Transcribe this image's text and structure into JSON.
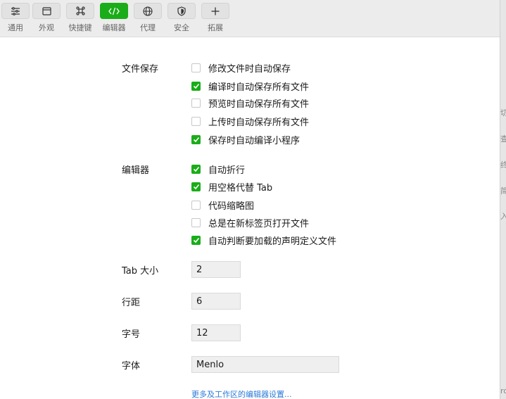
{
  "toolbar": {
    "items": [
      {
        "label": "通用",
        "icon": "sliders-icon",
        "active": false
      },
      {
        "label": "外观",
        "icon": "window-icon",
        "active": false
      },
      {
        "label": "快捷键",
        "icon": "command-icon",
        "active": false
      },
      {
        "label": "编辑器",
        "icon": "code-icon",
        "active": true
      },
      {
        "label": "代理",
        "icon": "globe-icon",
        "active": false
      },
      {
        "label": "安全",
        "icon": "shield-icon",
        "active": false
      },
      {
        "label": "拓展",
        "icon": "plus-icon",
        "active": false
      }
    ]
  },
  "accent_color": "#1aad19",
  "right_strip": {
    "glyphs": [
      "切",
      "查",
      "终",
      "简",
      "入",
      "ro"
    ]
  },
  "file_save": {
    "label": "文件保存",
    "options": [
      {
        "label": "修改文件时自动保存",
        "checked": false
      },
      {
        "label": "编译时自动保存所有文件",
        "checked": true
      },
      {
        "label": "预览时自动保存所有文件",
        "checked": false
      },
      {
        "label": "上传时自动保存所有文件",
        "checked": false
      },
      {
        "label": "保存时自动编译小程序",
        "checked": true
      }
    ]
  },
  "editor": {
    "label": "编辑器",
    "options": [
      {
        "label": "自动折行",
        "checked": true
      },
      {
        "label": "用空格代替 Tab",
        "checked": true
      },
      {
        "label": "代码缩略图",
        "checked": false
      },
      {
        "label": "总是在新标签页打开文件",
        "checked": false
      },
      {
        "label": "自动判断要加载的声明定义文件",
        "checked": true
      }
    ]
  },
  "fields": {
    "tab_size": {
      "label": "Tab 大小",
      "value": "2"
    },
    "line_height": {
      "label": "行距",
      "value": "6"
    },
    "font_size": {
      "label": "字号",
      "value": "12"
    },
    "font_family": {
      "label": "字体",
      "value": "Menlo"
    }
  },
  "more_link": "更多及工作区的编辑器设置..."
}
